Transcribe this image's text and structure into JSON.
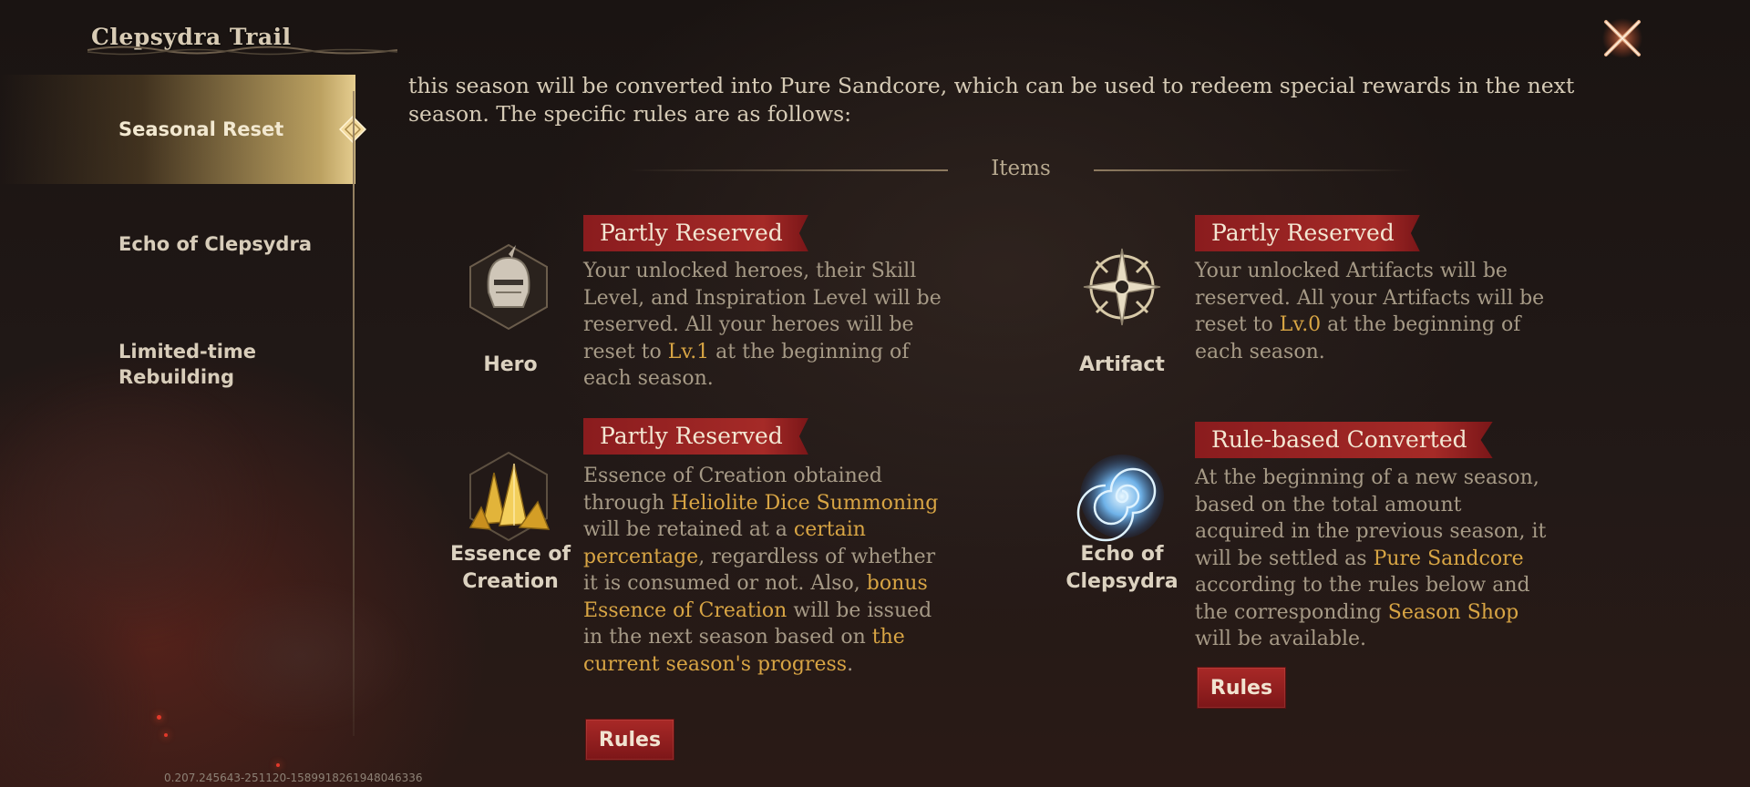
{
  "window": {
    "title": "Clepsydra Trail",
    "version": "0.207.245643-251120-1589918261948046336"
  },
  "sidebar": {
    "items": [
      {
        "label": "Seasonal Reset",
        "active": true
      },
      {
        "label": "Echo of Clepsydra",
        "active": false
      },
      {
        "label": "Limited-time Rebuilding",
        "active": false
      }
    ]
  },
  "main": {
    "intro": "this season will be converted into Pure Sandcore, which can be used to redeem special rewards in the next season. The specific rules are as follows:",
    "section_title": "Items",
    "cards": [
      {
        "name": "Hero",
        "tag": "Partly Reserved",
        "desc": [
          {
            "t": "Your unlocked heroes, their Skill Level, and Inspiration Level will be reserved. All your heroes will be reset to "
          },
          {
            "t": "Lv.1",
            "hl": true
          },
          {
            "t": " at the beginning of each season."
          }
        ]
      },
      {
        "name": "Artifact",
        "tag": "Partly Reserved",
        "desc": [
          {
            "t": "Your unlocked Artifacts will be reserved. All your Artifacts will be reset to "
          },
          {
            "t": "Lv.0",
            "hl": true
          },
          {
            "t": " at the beginning of each season."
          }
        ]
      },
      {
        "name": "Essence of Creation",
        "tag": "Partly Reserved",
        "rules_label": "Rules",
        "desc": [
          {
            "t": "Essence of Creation obtained through "
          },
          {
            "t": "Heliolite Dice Summoning",
            "hl": true
          },
          {
            "t": " will be retained at a "
          },
          {
            "t": "certain percentage",
            "hl": true
          },
          {
            "t": ", regardless of whether it is consumed or not. Also, "
          },
          {
            "t": "bonus Essence of Creation",
            "hl": true
          },
          {
            "t": " will be issued in the next season based on "
          },
          {
            "t": "the current season's progress",
            "hl": true
          },
          {
            "t": "."
          }
        ]
      },
      {
        "name": "Echo of Clepsydra",
        "tag": "Rule-based Converted",
        "rules_label": "Rules",
        "desc": [
          {
            "t": "At the beginning of a new season, based on the total amount acquired in the previous season, it will be settled as "
          },
          {
            "t": "Pure Sandcore",
            "hl": true
          },
          {
            "t": " according to the rules below and the corresponding "
          },
          {
            "t": "Season Shop",
            "hl": true
          },
          {
            "t": " will be available."
          }
        ]
      }
    ]
  },
  "colors": {
    "accent_red": "#a52a27",
    "highlight_gold": "#d8a544",
    "text_body": "#a69a86"
  },
  "icons": {
    "close": "close-x-icon",
    "hero": "knight-helmet-icon",
    "artifact": "compass-rose-icon",
    "essence": "gold-crystal-icon",
    "echo": "blue-vortex-icon"
  }
}
